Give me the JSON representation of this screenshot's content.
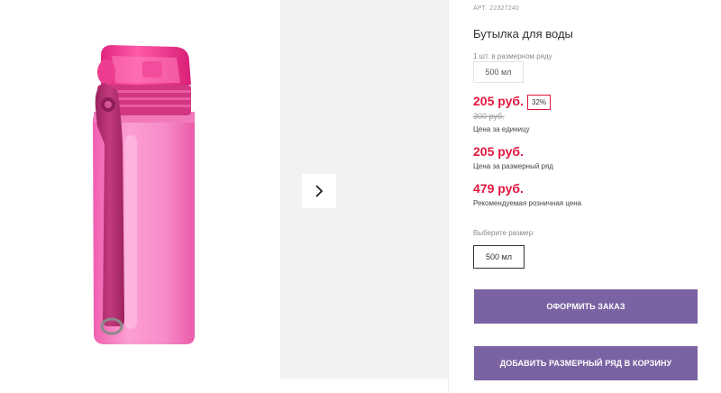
{
  "product": {
    "art_label": "АРТ.",
    "art_value": "22327240",
    "title": "Бутылка для воды",
    "pack_label": "1 шт. в размерном ряду",
    "pack_value": "500 мл"
  },
  "pricing": {
    "price": "205 руб.",
    "discount": "32%",
    "old_price": "300 руб.",
    "unit_label": "Цена за единицу",
    "range_price": "205 руб.",
    "range_label": "Цена за размерный ряд",
    "retail_price": "479 руб.",
    "retail_label": "Рекомендуемая розничная цена"
  },
  "size": {
    "label": "Выберите размер:",
    "options": [
      "500 мл"
    ]
  },
  "actions": {
    "order": "ОФОРМИТЬ ЗАКАЗ",
    "add_to_cart": "ДОБАВИТЬ РАЗМЕРНЫЙ РЯД В КОРЗИНУ"
  },
  "colors": {
    "price_red": "#e3173e",
    "button_purple": "#7b62a3",
    "bottle_pink": "#f47fc0",
    "strap_magenta": "#b02a6c"
  },
  "icons": {
    "gallery_next": "chevron-right-icon"
  }
}
